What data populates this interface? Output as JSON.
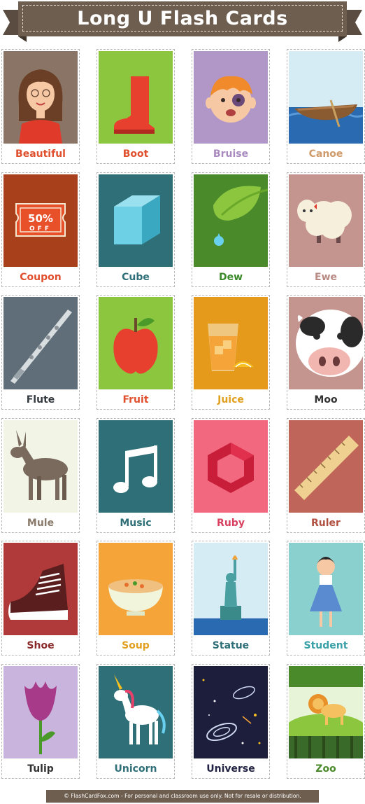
{
  "title": "Long U Flash Cards",
  "footer": "© FlashCardFox.com - For personal and classroom use only. Not for resale or distribution.",
  "cards": [
    {
      "label": "Beautiful",
      "color": "#e0502e",
      "bg": "#8a7466",
      "icon": "woman-icon"
    },
    {
      "label": "Boot",
      "color": "#e0502e",
      "bg": "#8cc63f",
      "icon": "boot-icon"
    },
    {
      "label": "Bruise",
      "color": "#a98bbf",
      "bg": "#b196c8",
      "icon": "bruised-boy-icon"
    },
    {
      "label": "Canoe",
      "color": "#d09a6a",
      "bg": "#d5ecf5",
      "icon": "canoe-icon"
    },
    {
      "label": "Coupon",
      "color": "#e0502e",
      "bg": "#a8401c",
      "icon": "coupon-icon"
    },
    {
      "label": "Cube",
      "color": "#2f6f78",
      "bg": "#2f6f78",
      "icon": "cube-icon"
    },
    {
      "label": "Dew",
      "color": "#3a8a2a",
      "bg": "#4a8a2a",
      "icon": "dew-leaf-icon"
    },
    {
      "label": "Ewe",
      "color": "#b98a84",
      "bg": "#c4948e",
      "icon": "sheep-icon"
    },
    {
      "label": "Flute",
      "color": "#333a40",
      "bg": "#5f6e78",
      "icon": "flute-icon"
    },
    {
      "label": "Fruit",
      "color": "#e0502e",
      "bg": "#8cc63f",
      "icon": "apple-icon"
    },
    {
      "label": "Juice",
      "color": "#e0a020",
      "bg": "#e59a1c",
      "icon": "juice-icon"
    },
    {
      "label": "Moo",
      "color": "#333333",
      "bg": "#c4948e",
      "icon": "cow-icon"
    },
    {
      "label": "Mule",
      "color": "#8a7a6a",
      "bg": "#f2f5e6",
      "icon": "mule-icon"
    },
    {
      "label": "Music",
      "color": "#2f6f78",
      "bg": "#2f6f78",
      "icon": "music-note-icon"
    },
    {
      "label": "Ruby",
      "color": "#d84060",
      "bg": "#f2687e",
      "icon": "ruby-icon"
    },
    {
      "label": "Ruler",
      "color": "#b05040",
      "bg": "#c0655a",
      "icon": "ruler-icon"
    },
    {
      "label": "Shoe",
      "color": "#8a2a2a",
      "bg": "#b03a3a",
      "icon": "shoe-icon"
    },
    {
      "label": "Soup",
      "color": "#e0a020",
      "bg": "#f5a43a",
      "icon": "soup-icon"
    },
    {
      "label": "Statue",
      "color": "#2f6f78",
      "bg": "#d5ecf5",
      "icon": "statue-of-liberty-icon"
    },
    {
      "label": "Student",
      "color": "#3aa0a8",
      "bg": "#8ad0cf",
      "icon": "student-icon"
    },
    {
      "label": "Tulip",
      "color": "#333333",
      "bg": "#c8b4dc",
      "icon": "tulip-icon"
    },
    {
      "label": "Unicorn",
      "color": "#2f6f78",
      "bg": "#2f6f78",
      "icon": "unicorn-icon"
    },
    {
      "label": "Universe",
      "color": "#222244",
      "bg": "#1c1e3c",
      "icon": "galaxy-icon"
    },
    {
      "label": "Zoo",
      "color": "#4a8a2a",
      "bg": "#e8f4d8",
      "icon": "zoo-lion-icon"
    }
  ]
}
